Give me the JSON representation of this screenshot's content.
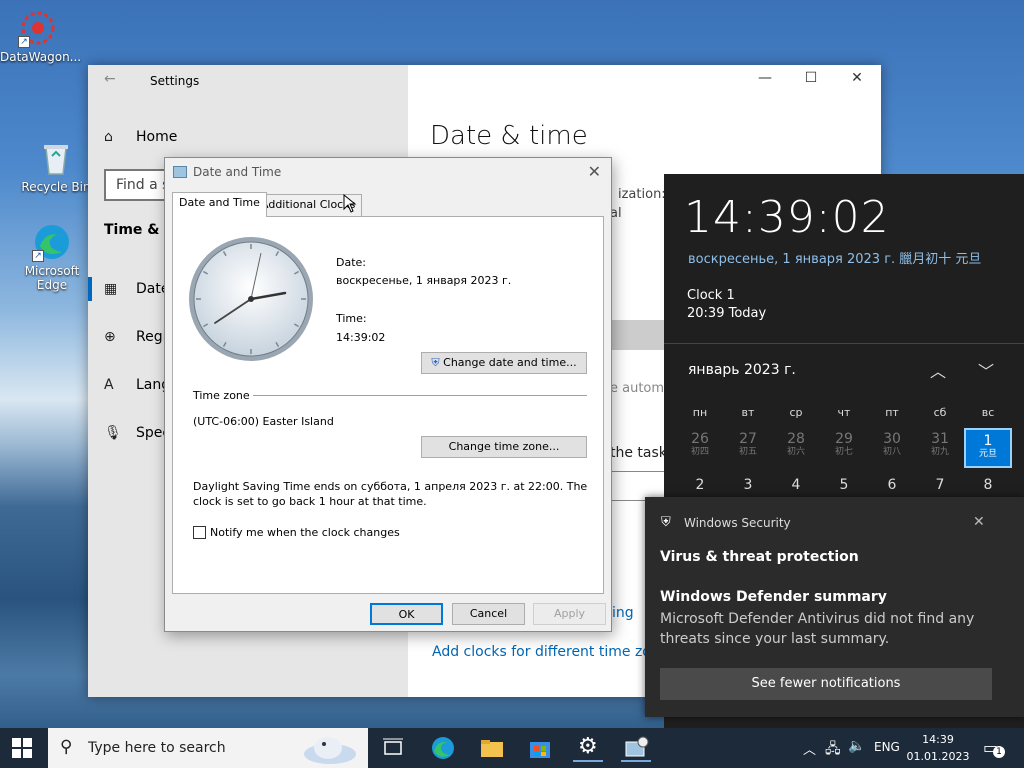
{
  "desktop": {
    "icons": [
      {
        "label": "DataWagon...",
        "icon": "datawagon-icon"
      },
      {
        "label": "Recycle Bin",
        "icon": "recycle-bin-icon"
      },
      {
        "label": "Microsoft Edge",
        "icon": "edge-icon"
      }
    ]
  },
  "settings": {
    "title": "Settings",
    "home": "Home",
    "search_placeholder": "Find a s",
    "section": "Time & La",
    "nav": [
      {
        "label": "Date",
        "icon": "calendar-icon"
      },
      {
        "label": "Regi",
        "icon": "region-icon"
      },
      {
        "label": "Lang",
        "icon": "language-icon"
      },
      {
        "label": "Spee",
        "icon": "microphone-icon"
      }
    ],
    "page_title": "Date & time",
    "ghost_1": "ization: C",
    "ghost_2": "al",
    "ghost_3": "e autom",
    "ghost_4": "the task",
    "link_1": "ing",
    "link_2": "Add clocks for different time zones"
  },
  "dialog": {
    "title": "Date and Time",
    "tabs": [
      "Date and Time",
      "Additional Clocks"
    ],
    "date_label": "Date:",
    "date_value": "воскресенье, 1 января 2023 г.",
    "time_label": "Time:",
    "time_value": "14:39:02",
    "change_date_btn": "Change date and time...",
    "tz_header": "Time zone",
    "tz_value": "(UTC-06:00) Easter Island",
    "change_tz_btn": "Change time zone...",
    "dst_text": "Daylight Saving Time ends on суббота, 1 апреля 2023 г. at 22:00. The clock is set to go back 1 hour at that time.",
    "notify_label": "Notify me when the clock changes",
    "notify_checked": false,
    "ok": "OK",
    "cancel": "Cancel",
    "apply": "Apply"
  },
  "flyout": {
    "time": "14:39:02",
    "date_line": "воскресенье, 1 января 2023 г. 臘月初十 元旦",
    "clock_name": "Clock 1",
    "clock_time": "20:39 Today",
    "month": "январь 2023 г.",
    "weekdays": [
      "пн",
      "вт",
      "ср",
      "чт",
      "пт",
      "сб",
      "вс"
    ],
    "row1": [
      {
        "d": "26",
        "s": "初四"
      },
      {
        "d": "27",
        "s": "初五"
      },
      {
        "d": "28",
        "s": "初六"
      },
      {
        "d": "29",
        "s": "初七"
      },
      {
        "d": "30",
        "s": "初八"
      },
      {
        "d": "31",
        "s": "初九"
      },
      {
        "d": "1",
        "s": "元旦"
      }
    ],
    "row2": [
      {
        "d": "2",
        "s": ""
      },
      {
        "d": "3",
        "s": ""
      },
      {
        "d": "4",
        "s": ""
      },
      {
        "d": "5",
        "s": ""
      },
      {
        "d": "6",
        "s": ""
      },
      {
        "d": "7",
        "s": ""
      },
      {
        "d": "8",
        "s": ""
      }
    ],
    "today_color": "#0078d7"
  },
  "toast": {
    "app": "Windows Security",
    "heading": "Virus & threat protection",
    "title": "Windows Defender summary",
    "body": "Microsoft Defender Antivirus did not find any threats since your last summary.",
    "button": "See fewer notifications"
  },
  "taskbar": {
    "search_placeholder": "Type here to search",
    "lang": "ENG",
    "time": "14:39",
    "date": "01.01.2023",
    "notif_count": "1"
  }
}
